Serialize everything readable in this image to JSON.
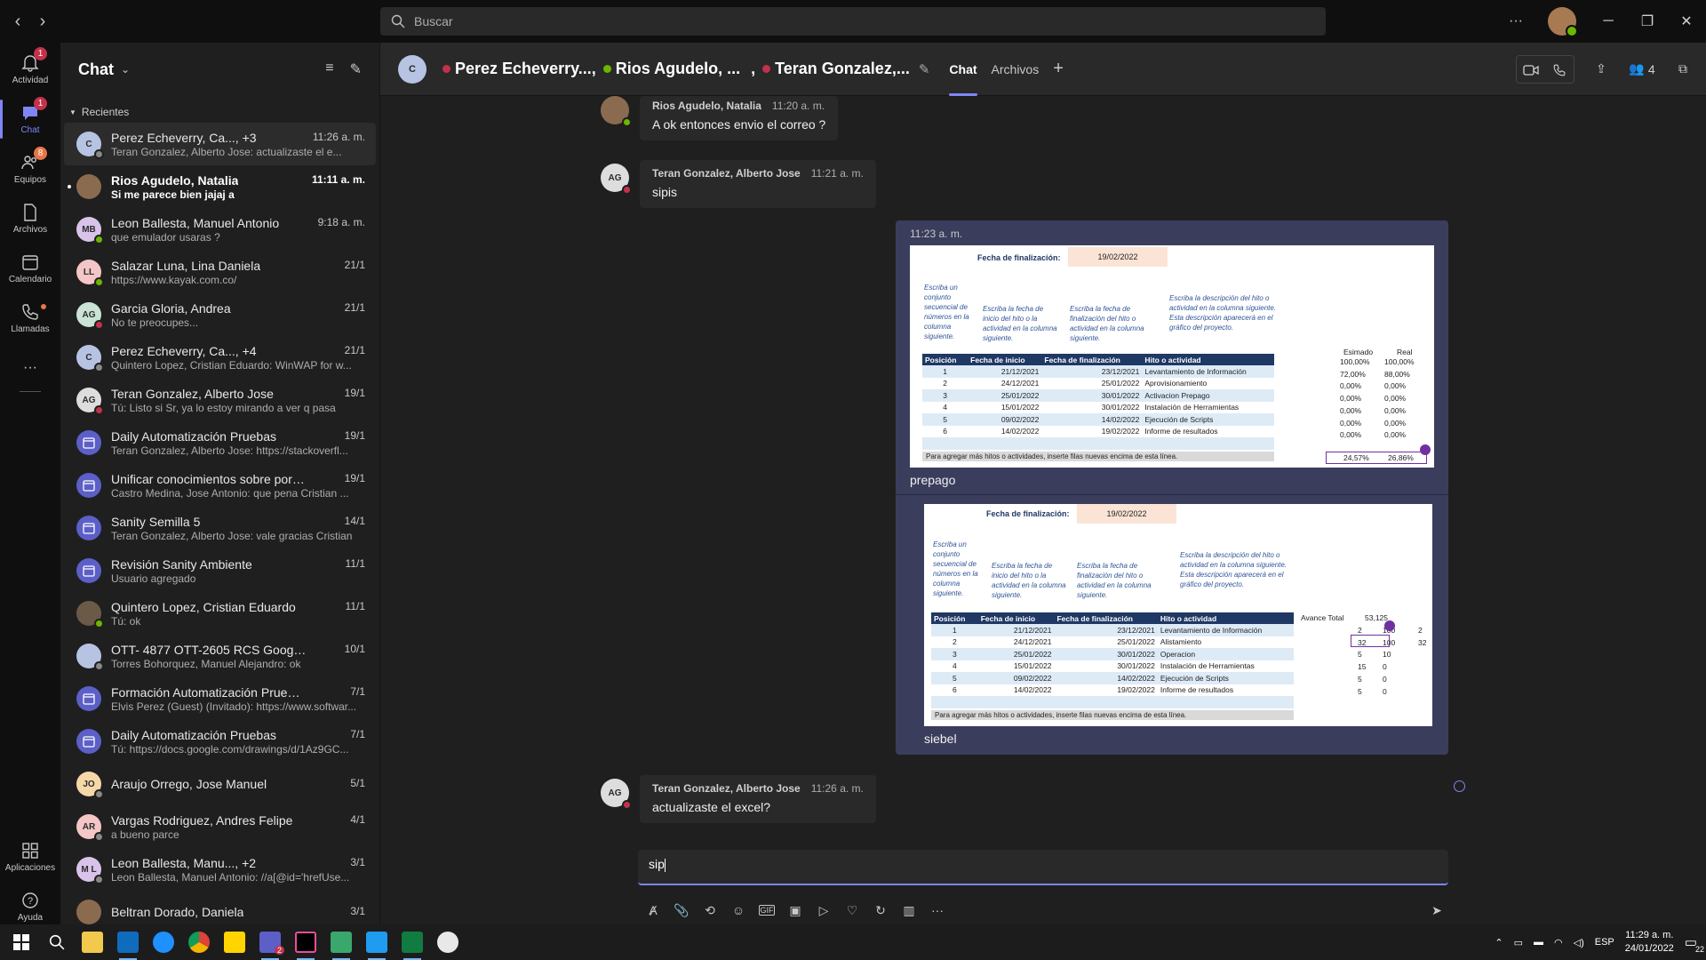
{
  "topbar": {
    "search_placeholder": "Buscar",
    "more": "···"
  },
  "rail": [
    {
      "label": "Actividad",
      "badge": "1"
    },
    {
      "label": "Chat",
      "badge": "1"
    },
    {
      "label": "Equipos",
      "badge": "8"
    },
    {
      "label": "Archivos"
    },
    {
      "label": "Calendario"
    },
    {
      "label": "Llamadas"
    },
    {
      "label": "···"
    },
    {
      "label": "Aplicaciones"
    },
    {
      "label": "Ayuda"
    }
  ],
  "chatlist": {
    "title": "Chat",
    "section": "Recientes",
    "items": [
      {
        "name": "Perez Echeverry, Ca..., +3",
        "time": "11:26 a. m.",
        "preview": "Teran Gonzalez, Alberto Jose: actualizaste el e...",
        "initials": "C",
        "avatar_color": "#b7c3e3"
      },
      {
        "name": "Rios Agudelo, Natalia",
        "time": "11:11 a. m.",
        "preview": "Si me parece bien jajaj a",
        "initials": "",
        "avatar_color": "#8a6b4f"
      },
      {
        "name": "Leon Ballesta, Manuel Antonio",
        "time": "9:18 a. m.",
        "preview": "que emulador usaras ?",
        "initials": "MB",
        "avatar_color": "#d9c3e9"
      },
      {
        "name": "Salazar Luna, Lina Daniela",
        "time": "21/1",
        "preview": "https://www.kayak.com.co/",
        "initials": "LL",
        "avatar_color": "#f4c6c6"
      },
      {
        "name": "Garcia Gloria, Andrea",
        "time": "21/1",
        "preview": "No te preocupes...",
        "initials": "AG",
        "avatar_color": "#c9e3d6"
      },
      {
        "name": "Perez Echeverry, Ca..., +4",
        "time": "21/1",
        "preview": "Quintero Lopez, Cristian Eduardo: WinWAP for w...",
        "initials": "C",
        "avatar_color": "#b7c3e3"
      },
      {
        "name": "Teran Gonzalez, Alberto Jose",
        "time": "19/1",
        "preview": "Tú: Listo si Sr, ya lo estoy mirando a ver q pasa",
        "initials": "AG",
        "avatar_color": "#dddddd"
      },
      {
        "name": "Daily Automatización Pruebas",
        "time": "19/1",
        "preview": "Teran Gonzalez, Alberto Jose: https://stackoverfl...",
        "initials": "",
        "avatar_color": "#5b5fc7"
      },
      {
        "name": "Unificar conocimientos sobre portabili...",
        "time": "19/1",
        "preview": "Castro Medina, Jose Antonio: que pena Cristian ...",
        "initials": "",
        "avatar_color": "#5b5fc7"
      },
      {
        "name": "Sanity Semilla 5",
        "time": "14/1",
        "preview": "Teran Gonzalez, Alberto Jose: vale gracias Cristian",
        "initials": "",
        "avatar_color": "#5b5fc7"
      },
      {
        "name": "Revisión Sanity Ambiente",
        "time": "11/1",
        "preview": "Usuario agregado",
        "initials": "",
        "avatar_color": "#5b5fc7"
      },
      {
        "name": "Quintero Lopez, Cristian Eduardo",
        "time": "11/1",
        "preview": "Tú: ok",
        "initials": "",
        "avatar_color": "#6b5a48"
      },
      {
        "name": "OTT- 4877 OTT-2605 RCS Google OTT-...",
        "time": "10/1",
        "preview": "Torres Bohorquez, Manuel Alejandro: ok",
        "initials": "",
        "avatar_color": "#b7c3e3"
      },
      {
        "name": "Formación Automatización Pruebas",
        "time": "7/1",
        "preview": "Elvis Perez (Guest) (Invitado): https://www.softwar...",
        "initials": "",
        "avatar_color": "#5b5fc7"
      },
      {
        "name": "Daily Automatización Pruebas",
        "time": "7/1",
        "preview": "Tú: https://docs.google.com/drawings/d/1Az9GC...",
        "initials": "",
        "avatar_color": "#5b5fc7"
      },
      {
        "name": "Araujo Orrego, Jose Manuel",
        "time": "5/1",
        "preview": "",
        "initials": "JO",
        "avatar_color": "#f6d7a7"
      },
      {
        "name": "Vargas Rodriguez, Andres Felipe",
        "time": "4/1",
        "preview": "a bueno parce",
        "initials": "AR",
        "avatar_color": "#f4c6c6"
      },
      {
        "name": "Leon Ballesta, Manu..., +2",
        "time": "3/1",
        "preview": "Leon Ballesta, Manuel Antonio: //a[@id='hrefUse...",
        "initials": "M L",
        "avatar_color": "#d9c3e9"
      },
      {
        "name": "Beltran Dorado, Daniela",
        "time": "3/1",
        "preview": "",
        "initials": "",
        "avatar_color": "#8a6b4f"
      }
    ]
  },
  "conversation": {
    "header": {
      "initials": "C",
      "names": [
        "Perez Echeverry...,",
        "Rios Agudelo, ...",
        ",",
        "Teran Gonzalez,..."
      ],
      "tabs": [
        "Chat",
        "Archivos"
      ],
      "participants": "4"
    },
    "messages": [
      {
        "author": "Rios Agudelo, Natalia",
        "time": "11:20 a. m.",
        "text": "A ok entonces envio el correo ?"
      },
      {
        "author": "Teran Gonzalez, Alberto Jose",
        "time": "11:21 a. m.",
        "text": "sipis",
        "initials": "AG"
      },
      {
        "author": "Teran Gonzalez, Alberto Jose",
        "time": "11:26 a. m.",
        "text": "actualizaste el excel?",
        "initials": "AG"
      }
    ],
    "mine": {
      "time": "11:23 a. m.",
      "caption1": "prepago",
      "caption2": "siebel"
    },
    "compose_text": "sip"
  },
  "sheet1": {
    "end_label": "Fecha de finalización:",
    "end_value": "19/02/2022",
    "descs": [
      "Escriba un conjunto secuencial de números en la columna siguiente.",
      "Escriba la fecha de inicio del hito o la actividad en la columna siguiente.",
      "Escriba la fecha de finalización del hito o actividad en la columna siguiente.",
      "Escriba la descripción del hito o actividad en la columna siguiente. Esta descripción aparecerá en el gráfico del proyecto."
    ],
    "headers": [
      "Posición",
      "Fecha de inicio",
      "Fecha de finalización",
      "Hito o actividad"
    ],
    "rows": [
      [
        "1",
        "21/12/2021",
        "23/12/2021",
        "Levantamiento de Información"
      ],
      [
        "2",
        "24/12/2021",
        "25/01/2022",
        "Aprovisionamiento"
      ],
      [
        "3",
        "25/01/2022",
        "30/01/2022",
        "Activacion Prepago"
      ],
      [
        "4",
        "15/01/2022",
        "30/01/2022",
        "Instalación de Herramientas"
      ],
      [
        "5",
        "09/02/2022",
        "14/02/2022",
        "Ejecución de Scripts"
      ],
      [
        "6",
        "14/02/2022",
        "19/02/2022",
        "Informe de resultados"
      ]
    ],
    "side_headers": [
      "Esimado",
      "Real"
    ],
    "side_rows": [
      [
        "100,00%",
        "100,00%"
      ],
      [
        "72,00%",
        "88,00%"
      ],
      [
        "0,00%",
        "0,00%"
      ],
      [
        "0,00%",
        "0,00%"
      ],
      [
        "0,00%",
        "0,00%"
      ],
      [
        "0,00%",
        "0,00%"
      ],
      [
        "0,00%",
        "0,00%"
      ]
    ],
    "totals": [
      "24,57%",
      "26,86%"
    ],
    "footer": "Para agregar más hitos o actividades, inserte filas nuevas encima de esta línea."
  },
  "sheet2": {
    "end_label": "Fecha de finalización:",
    "end_value": "19/02/2022",
    "descs": [
      "Escriba un conjunto secuencial de números en la columna siguiente.",
      "Escriba la fecha de inicio del hito o la actividad en la columna siguiente.",
      "Escriba la fecha de finalización del hito o actividad en la columna siguiente.",
      "Escriba la descripción del hito o actividad en la columna siguiente. Esta descripción aparecerá en el gráfico del proyecto."
    ],
    "headers": [
      "Posición",
      "Fecha de inicio",
      "Fecha de finalización",
      "Hito o actividad"
    ],
    "rows": [
      [
        "1",
        "21/12/2021",
        "23/12/2021",
        "Levantamiento de Información"
      ],
      [
        "2",
        "24/12/2021",
        "25/01/2022",
        "Alistamiento"
      ],
      [
        "3",
        "25/01/2022",
        "30/01/2022",
        "Operacion"
      ],
      [
        "4",
        "15/01/2022",
        "30/01/2022",
        "Instalación de Herramientas"
      ],
      [
        "5",
        "09/02/2022",
        "14/02/2022",
        "Ejecución de Scripts"
      ],
      [
        "6",
        "14/02/2022",
        "19/02/2022",
        "Informe de resultados"
      ]
    ],
    "avance_label": "Avance Total",
    "avance_value": "53,125",
    "side_rows": [
      [
        "2",
        "100",
        "2"
      ],
      [
        "32",
        "100",
        "32"
      ],
      [
        "5",
        "10",
        ""
      ],
      [
        "15",
        "0",
        ""
      ],
      [
        "5",
        "0",
        ""
      ],
      [
        "5",
        "0",
        ""
      ]
    ],
    "footer": "Para agregar más hitos o actividades, inserte filas nuevas encima de esta línea."
  },
  "taskbar": {
    "lang": "ESP",
    "time": "11:29 a. m.",
    "date": "24/01/2022",
    "notif": "22",
    "teams_badge": "2"
  }
}
